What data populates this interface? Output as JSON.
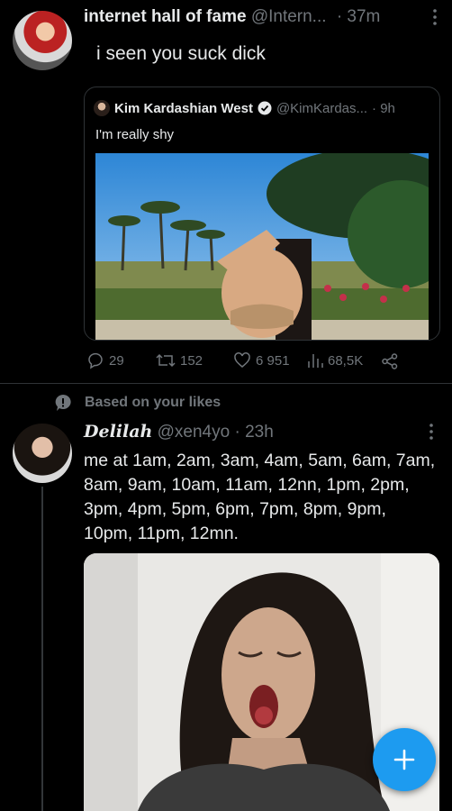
{
  "tweet1": {
    "author_name": "internet hall of fame",
    "handle": "@Intern...",
    "separator": "·",
    "time": "37m",
    "text": "i seen you suck dick",
    "quote": {
      "author_name": "Kim Kardashian West",
      "handle": "@KimKardas...",
      "time": "· 9h",
      "text": "I'm really shy"
    },
    "actions": {
      "replies": "29",
      "retweets": "152",
      "likes": "6 951",
      "views": "68,5K"
    }
  },
  "recommendation": {
    "label": "Based on your likes"
  },
  "tweet2": {
    "author_name": "Delilah",
    "handle": "@xen4yo",
    "time": "· 23h",
    "text": "me at 1am, 2am, 3am, 4am, 5am, 6am, 7am, 8am, 9am, 10am, 11am, 12nn, 1pm, 2pm, 3pm, 4pm, 5pm, 6pm, 7pm, 8pm, 9pm, 10pm, 11pm, 12mn."
  },
  "fab": {
    "icon": "plus-icon",
    "color": "#1d9bf0"
  },
  "colors": {
    "accent": "#1d9bf0",
    "muted": "#71767b",
    "border": "#2f3336"
  }
}
